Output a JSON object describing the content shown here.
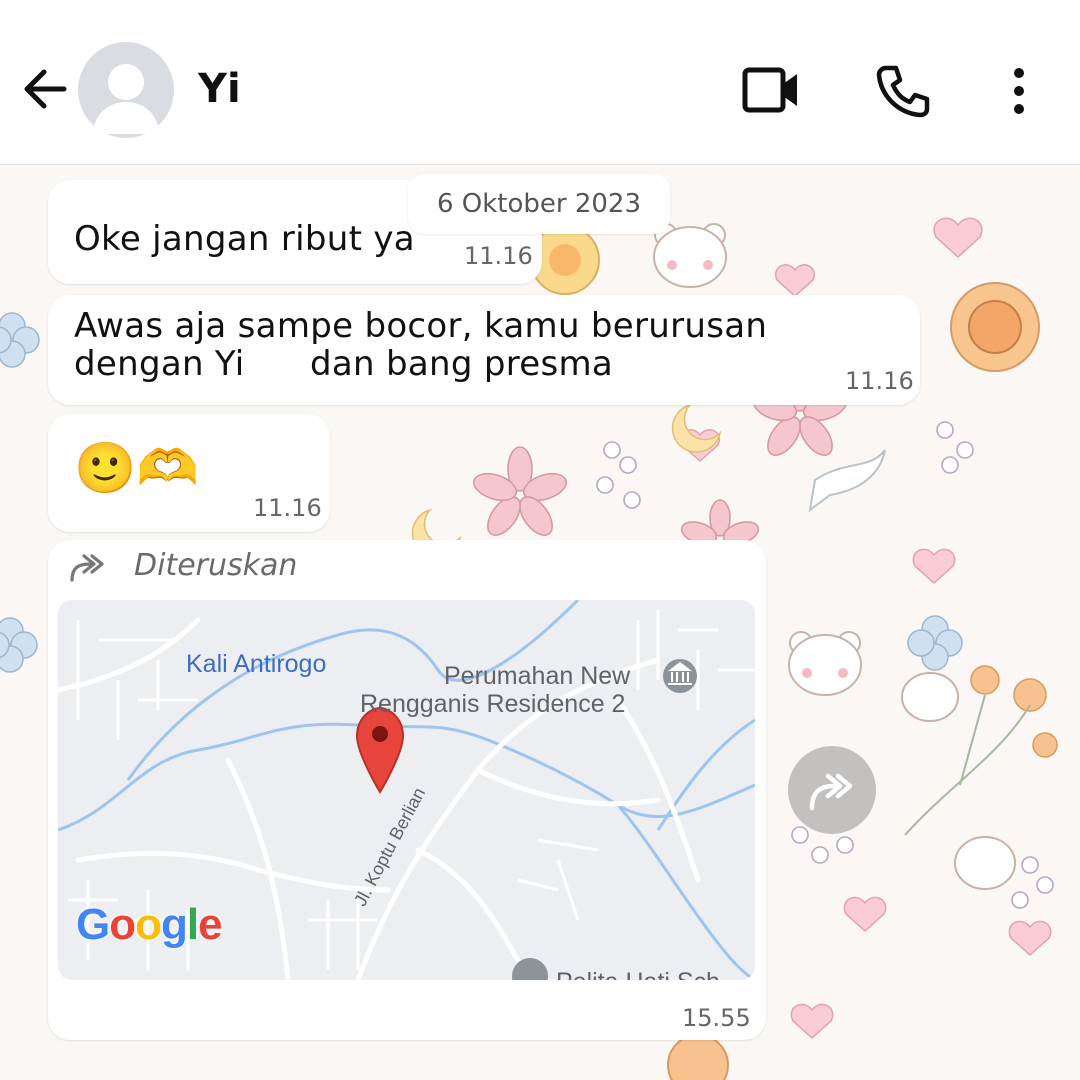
{
  "header": {
    "contact_name": "Yi",
    "icons": [
      "back-arrow-icon",
      "avatar-placeholder-icon",
      "video-call-icon",
      "voice-call-icon",
      "more-options-icon"
    ]
  },
  "chat": {
    "date_divider": "6 Oktober 2023",
    "messages": [
      {
        "text": "Oke jangan ribut ya",
        "time": "11.16"
      },
      {
        "line1": "Awas aja sampe bocor, kamu berurusan",
        "line2_a": "dengan Yi",
        "line2_b": "dan bang presma",
        "time": "11.16"
      },
      {
        "emoji": "🙂🫶",
        "time": "11.16"
      }
    ],
    "forwarded": {
      "label": "Diteruskan",
      "time": "15.55",
      "map": {
        "label_river": "Kali Antirogo",
        "label_place_1": "Perumahan New",
        "label_place_2": "Rengganis Residence 2",
        "label_road": "Jl. Koptu Berlian",
        "label_school": "Pelita Hati Sch",
        "logo_letters": [
          "G",
          "o",
          "o",
          "g",
          "l",
          "e"
        ],
        "logo_colors": [
          "#4285F4",
          "#EA4335",
          "#FBBC05",
          "#4285F4",
          "#34A853",
          "#EA4335"
        ]
      }
    }
  },
  "colors": {
    "bubble": "#ffffff",
    "water": "#9ec5f0",
    "pin": "#e8453c"
  }
}
